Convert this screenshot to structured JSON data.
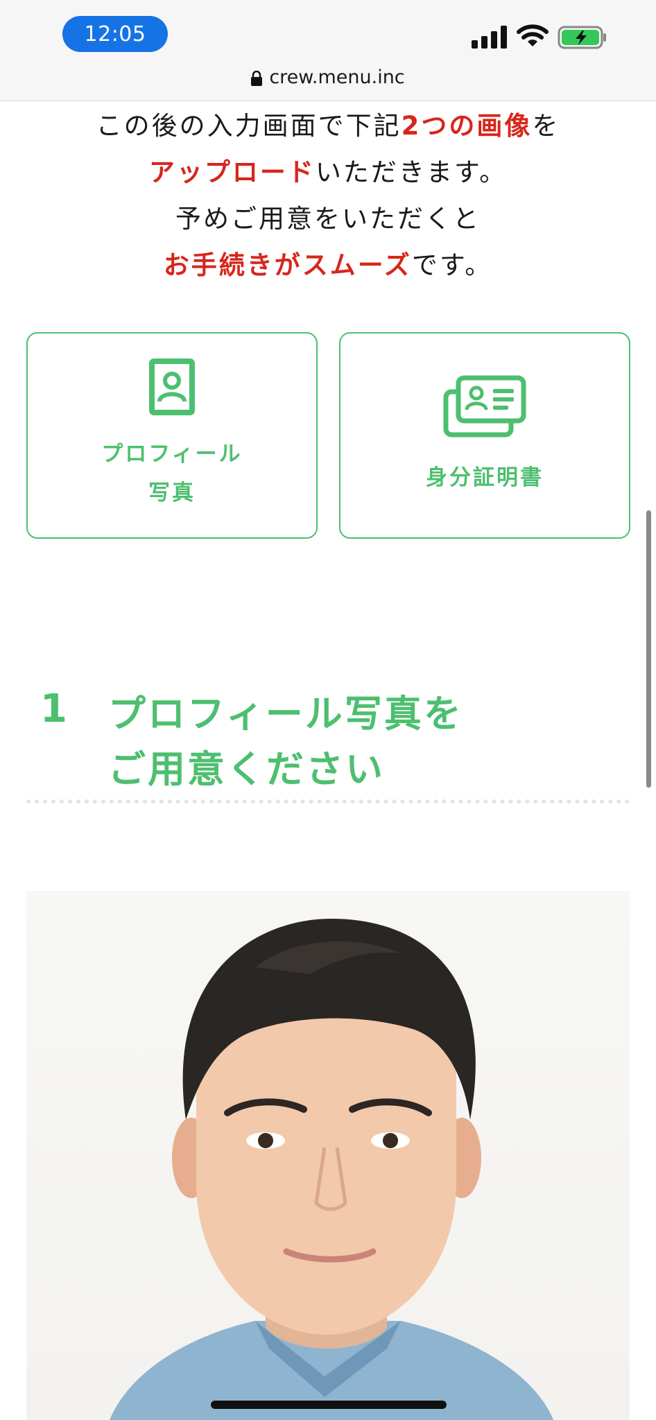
{
  "status_bar": {
    "time": "12:05"
  },
  "url_bar": {
    "domain": "crew.menu.inc"
  },
  "intro": {
    "line1_a": "この後の入力画面で下記",
    "line1_b": "2つの画像",
    "line1_c": "を",
    "line2_a": "アップロード",
    "line2_b": "いただきます。",
    "line3": "予めご用意をいただくと",
    "line4_a": "お手続きがスムーズ",
    "line4_b": "です。"
  },
  "cards": [
    {
      "label_line1": "プロフィール",
      "label_line2": "写真",
      "icon": "portrait-icon"
    },
    {
      "label_line1": "身分証明書",
      "icon": "id-card-icon"
    }
  ],
  "section": {
    "number": "1",
    "title_line1": "プロフィール写真を",
    "title_line2": "ご用意ください"
  },
  "colors": {
    "accent_green": "#4dbf6f",
    "emphasis_red": "#d7261b",
    "time_pill": "#1673e6"
  }
}
